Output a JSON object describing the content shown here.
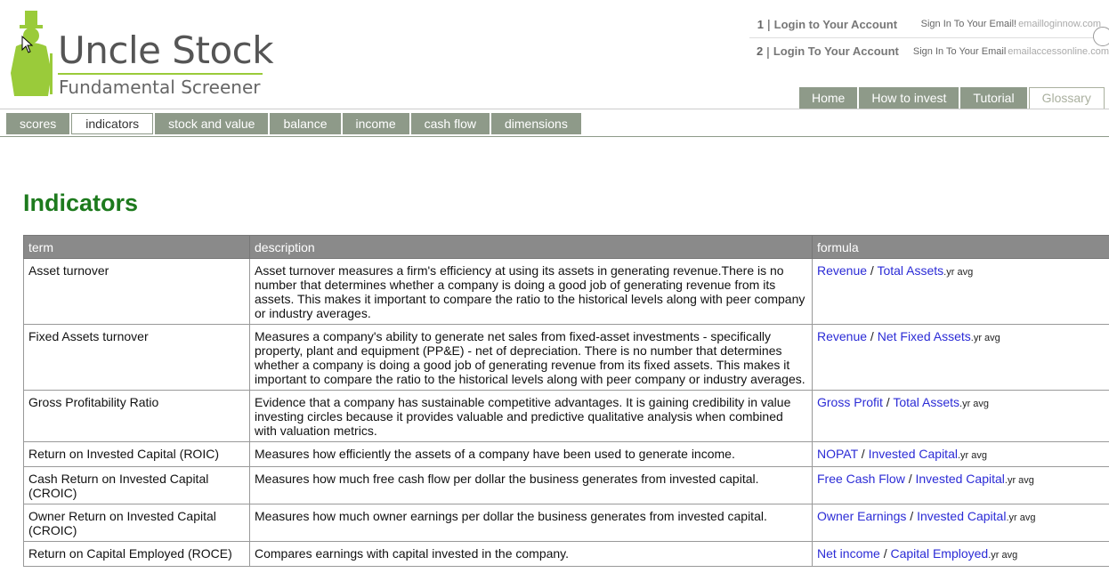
{
  "logo": {
    "title": "Uncle Stock",
    "subtitle": "Fundamental Screener",
    "accent_color": "#9acb3a",
    "icon": "top-hat-gentleman-icon"
  },
  "ads": [
    {
      "num": "1",
      "link": "Login to Your Account",
      "desc": "Sign In To Your Email!",
      "url": "emailloginnow.com"
    },
    {
      "num": "2",
      "link": "Login To Your Account",
      "desc": "Sign In To Your Email",
      "url": "emailaccessonline.com"
    }
  ],
  "main_nav": [
    {
      "label": "Home",
      "active": false
    },
    {
      "label": "How to invest",
      "active": false
    },
    {
      "label": "Tutorial",
      "active": false
    },
    {
      "label": "Glossary",
      "active": true
    }
  ],
  "sub_nav": [
    {
      "label": "scores",
      "active": false
    },
    {
      "label": "indicators",
      "active": true
    },
    {
      "label": "stock and value",
      "active": false
    },
    {
      "label": "balance",
      "active": false
    },
    {
      "label": "income",
      "active": false
    },
    {
      "label": "cash flow",
      "active": false
    },
    {
      "label": "dimensions",
      "active": false
    }
  ],
  "page_title": "Indicators",
  "table": {
    "headers": [
      "term",
      "description",
      "formula"
    ],
    "rows": [
      {
        "term": "Asset turnover",
        "description": "Asset turnover measures a firm's efficiency at using its assets in generating revenue.There is no number that determines whether a company is doing a good job of generating revenue from its assets. This makes it important to compare the ratio to the historical levels along with peer company or industry averages.",
        "numerator": "Revenue",
        "operator": " / ",
        "denominator": "Total Assets",
        "suffix": ".yr avg"
      },
      {
        "term": "Fixed Assets turnover",
        "description": "Measures a company's ability to generate net sales from fixed-asset investments - specifically property, plant and equipment (PP&E) - net of depreciation. There is no number that determines whether a company is doing a good job of generating revenue from its fixed assets. This makes it important to compare the ratio to the historical levels along with peer company or industry averages.",
        "numerator": "Revenue",
        "operator": " / ",
        "denominator": "Net Fixed Assets",
        "suffix": ".yr avg"
      },
      {
        "term": "Gross Profitability Ratio",
        "description": "Evidence that a company has sustainable competitive advantages. It is gaining credibility in value investing circles because it provides valuable and predictive qualitative analysis when combined with valuation metrics.",
        "numerator": "Gross Profit",
        "operator": " / ",
        "denominator": "Total Assets",
        "suffix": ".yr avg"
      },
      {
        "term": "Return on Invested Capital (ROIC)",
        "description": "Measures how efficiently the assets of a company have been used to generate income.",
        "numerator": "NOPAT",
        "operator": " / ",
        "denominator": "Invested Capital",
        "suffix": ".yr avg"
      },
      {
        "term": "Cash Return on Invested Capital (CROIC)",
        "description": "Measures how much free cash flow per dollar the business generates from invested capital.",
        "numerator": "Free Cash Flow",
        "operator": " / ",
        "denominator": "Invested Capital",
        "suffix": ".yr avg"
      },
      {
        "term": "Owner Return on Invested Capital (CROIC)",
        "description": "Measures how much owner earnings per dollar the business generates from invested capital.",
        "numerator": "Owner Earnings",
        "operator": " / ",
        "denominator": "Invested Capital",
        "suffix": ".yr avg"
      },
      {
        "term": "Return on Capital Employed (ROCE)",
        "description": "Compares earnings with capital invested in the company.",
        "numerator": "Net income",
        "operator": " / ",
        "denominator": "Capital Employed",
        "suffix": ".yr avg"
      }
    ]
  },
  "colors": {
    "tab_bg": "#8e9a89",
    "title_green": "#1d7a1d",
    "link_blue": "#2b2bd6",
    "header_gray": "#8a8a8a"
  }
}
